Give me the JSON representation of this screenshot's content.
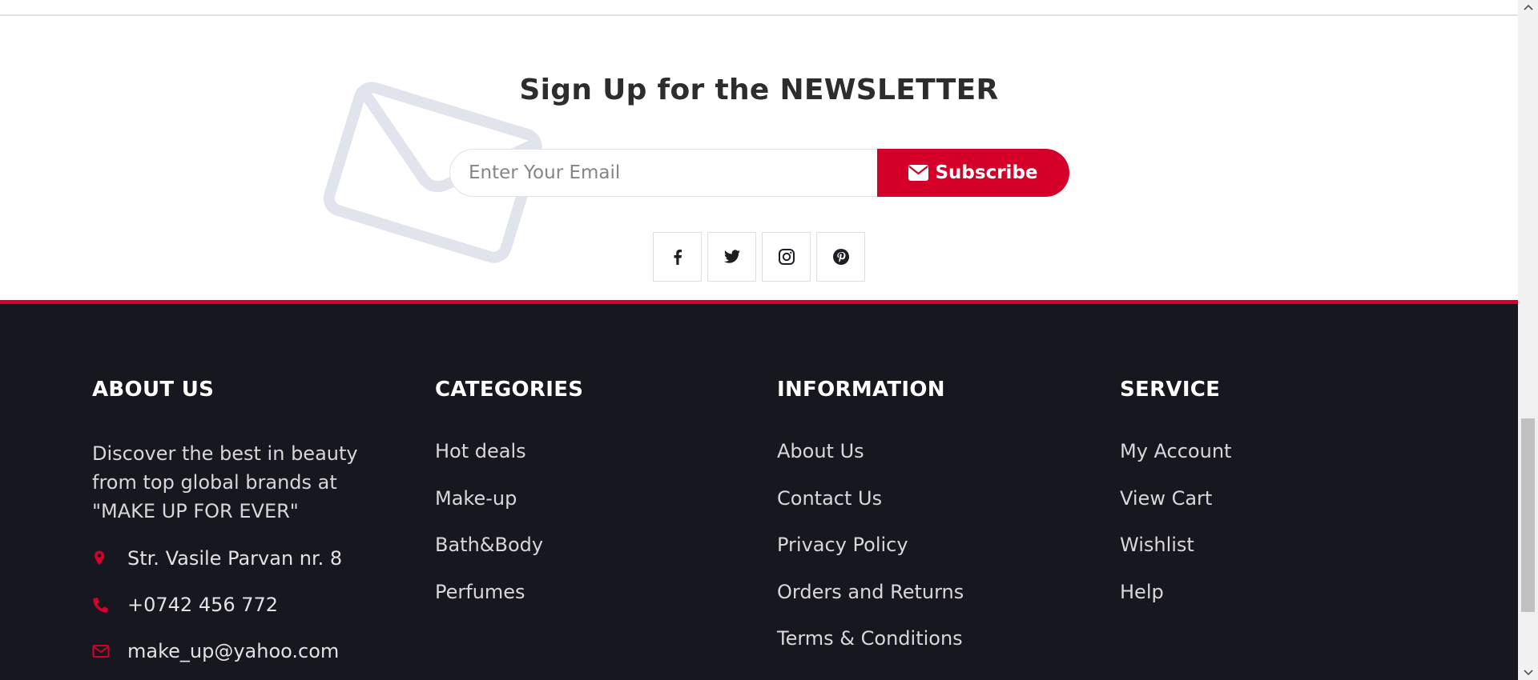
{
  "newsletter": {
    "title_regular": "Sign Up for the",
    "title_bold": "NEWSLETTER",
    "email_placeholder": "Enter Your Email",
    "subscribe_label": "Subscribe",
    "social": [
      {
        "icon": "facebook-icon"
      },
      {
        "icon": "twitter-icon"
      },
      {
        "icon": "instagram-icon"
      },
      {
        "icon": "pinterest-icon"
      }
    ]
  },
  "footer": {
    "accent_color": "#d4002a",
    "background_color": "#17171f",
    "about": {
      "heading": "ABOUT US",
      "text": "Discover the best in beauty from top global brands at \"MAKE UP FOR EVER\"",
      "address": "Str. Vasile Parvan nr. 8",
      "phone": "+0742 456 772",
      "email": "make_up@yahoo.com"
    },
    "categories": {
      "heading": "CATEGORIES",
      "items": [
        "Hot deals",
        "Make-up",
        "Bath&Body",
        "Perfumes"
      ]
    },
    "information": {
      "heading": "INFORMATION",
      "items": [
        "About Us",
        "Contact Us",
        "Privacy Policy",
        "Orders and Returns",
        "Terms & Conditions"
      ]
    },
    "service": {
      "heading": "SERVICE",
      "items": [
        "My Account",
        "View Cart",
        "Wishlist",
        "Help"
      ]
    }
  }
}
